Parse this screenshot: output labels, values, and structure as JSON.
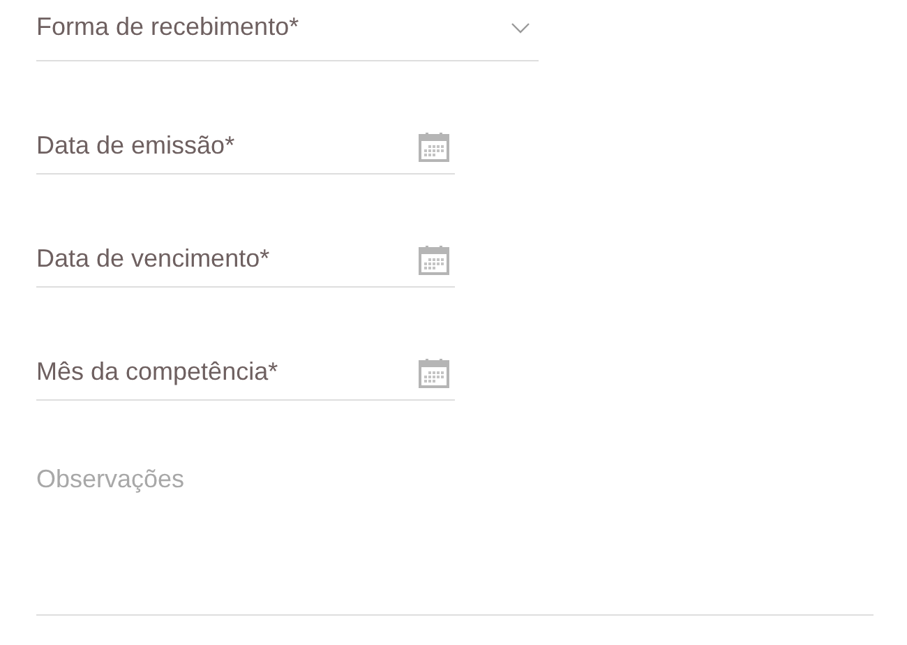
{
  "fields": [
    {
      "kind": "select",
      "label": "Forma de recebimento*"
    },
    {
      "kind": "date",
      "label": "Data de emissão*"
    },
    {
      "kind": "date",
      "label": "Data de vencimento*"
    },
    {
      "kind": "date",
      "label": "Mês da competência*"
    },
    {
      "kind": "textarea",
      "placeholder": "Observações"
    }
  ]
}
